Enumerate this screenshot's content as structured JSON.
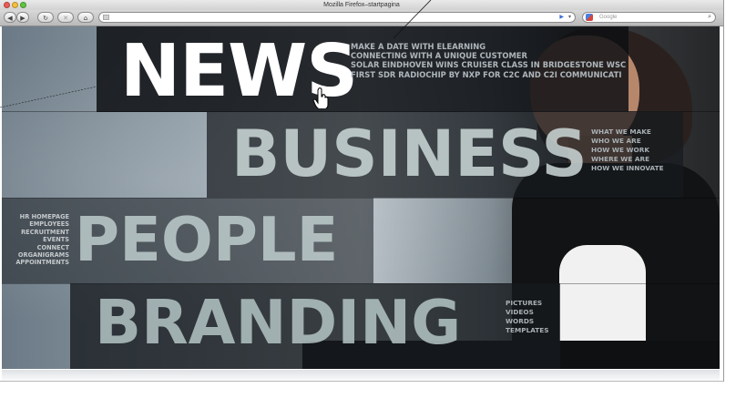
{
  "window": {
    "title": "Mozilla Firefox–startpagina"
  },
  "toolbar": {
    "search_placeholder": "Google"
  },
  "sections": {
    "news": {
      "word": "NEWS",
      "items": [
        "MAKE A DATE WITH ELEARNING",
        "CONNECTING WITH A UNIQUE CUSTOMER",
        "SOLAR EINDHOVEN WINS CRUISER CLASS IN BRIDGESTONE WSC",
        "FIRST SDR RADIOCHIP BY NXP FOR C2C AND C2I COMMUNICATI"
      ]
    },
    "business": {
      "word": "BUSINESS",
      "items": [
        "WHAT WE MAKE",
        "WHO WE ARE",
        "HOW WE WORK",
        "WHERE WE ARE",
        "HOW WE INNOVATE"
      ]
    },
    "people": {
      "word": "PEOPLE",
      "items": [
        "HR HOMEPAGE",
        "EMPLOYEES",
        "RECRUITMENT",
        "EVENTS",
        "CONNECT",
        "ORGANIGRAMS",
        "APPOINTMENTS"
      ]
    },
    "branding": {
      "word": "BRANDING",
      "items": [
        "PICTURES",
        "VIDEOS",
        "WORDS",
        "TEMPLATES"
      ]
    }
  },
  "colors": {
    "news_word": "#ffffff",
    "band_dark": "#12161a",
    "menu_text": "#aeb6bb"
  },
  "icons": [
    "back-icon",
    "forward-icon",
    "reload-icon",
    "stop-icon",
    "home-icon",
    "go-icon",
    "search-icon",
    "hand-cursor-icon"
  ]
}
